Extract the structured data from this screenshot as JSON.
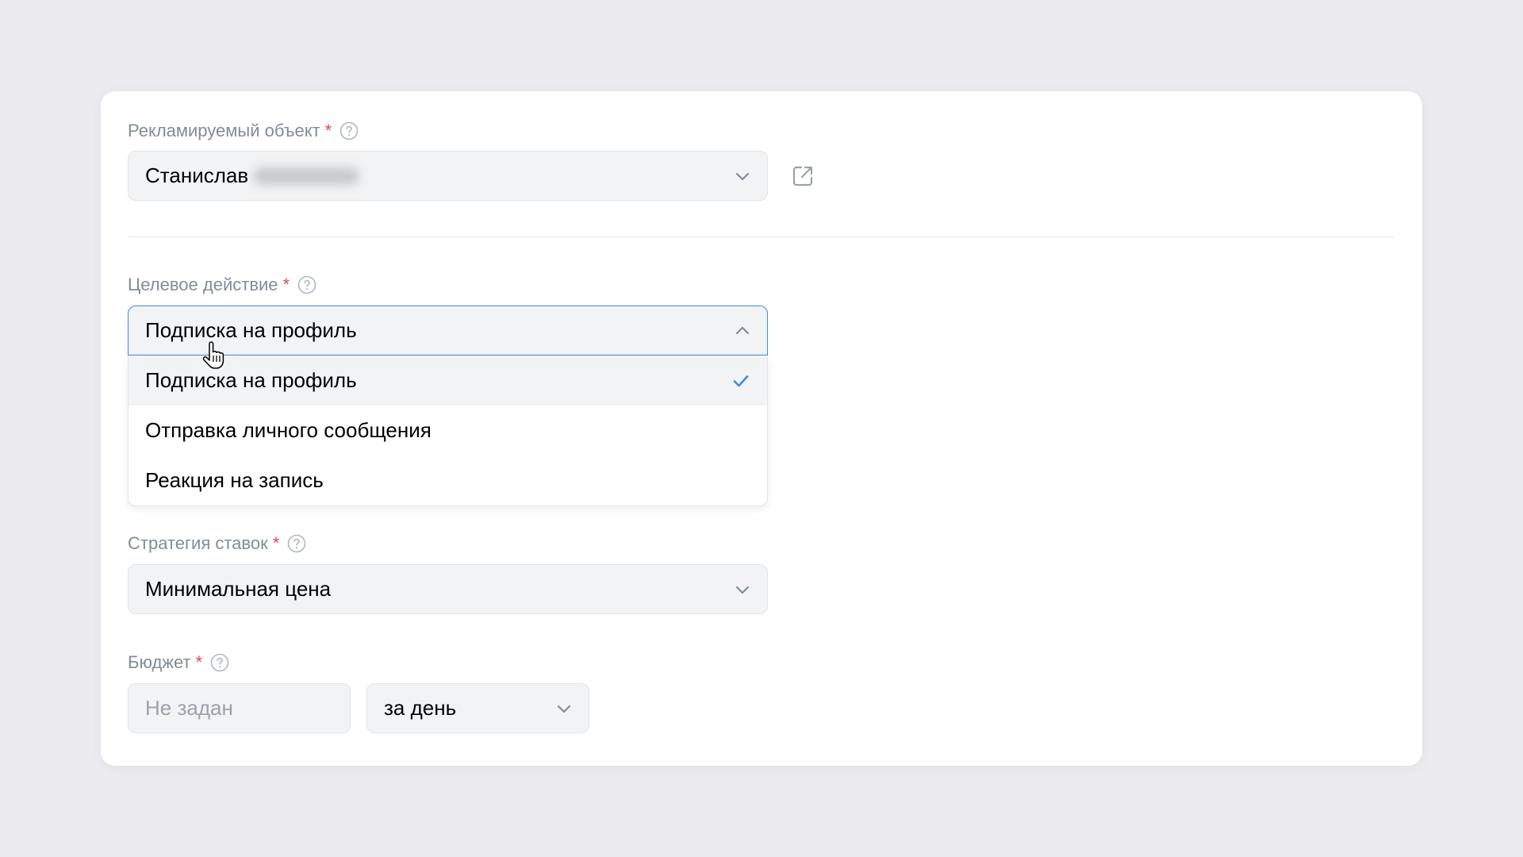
{
  "fields": {
    "promoted_object": {
      "label": "Рекламируемый объект",
      "required_mark": "*",
      "value": "Станислав"
    },
    "target_action": {
      "label": "Целевое действие",
      "required_mark": "*",
      "value": "Подписка на профиль",
      "options": [
        {
          "label": "Подписка на профиль",
          "selected": true
        },
        {
          "label": "Отправка личного сообщения",
          "selected": false
        },
        {
          "label": "Реакция на запись",
          "selected": false
        }
      ]
    },
    "bid_strategy": {
      "label": "Стратегия ставок",
      "required_mark": "*",
      "value": "Минимальная цена"
    },
    "budget": {
      "label": "Бюджет",
      "required_mark": "*",
      "placeholder": "Не задан",
      "period": "за день"
    }
  },
  "colors": {
    "background": "#ececf0",
    "card": "#ffffff",
    "label": "#818c99",
    "required": "#e64646",
    "accent": "#3f8ae0",
    "field_bg": "#f2f3f5",
    "placeholder": "#99a2ad"
  },
  "icons": {
    "help": "question-circle-icon",
    "external": "external-link-icon",
    "chevron_down": "chevron-down-icon",
    "chevron_up": "chevron-up-icon",
    "check": "check-icon",
    "cursor": "hand-pointer-cursor"
  }
}
